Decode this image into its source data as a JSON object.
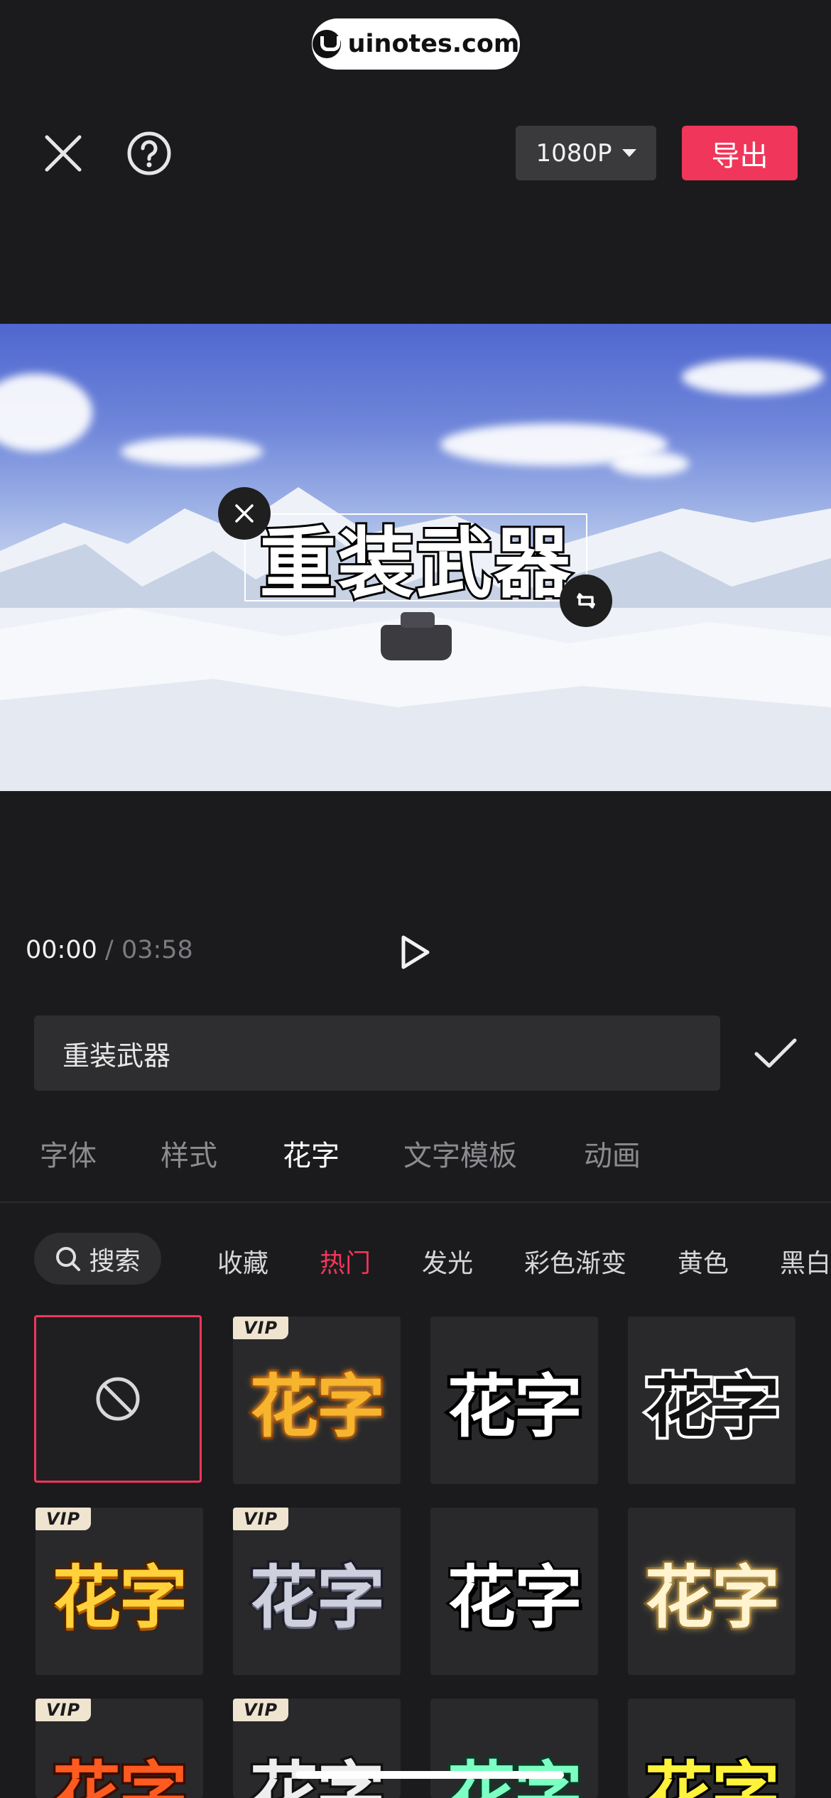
{
  "watermark": {
    "text": "uinotes.com"
  },
  "header": {
    "close_icon": "close-icon",
    "help_icon": "help-icon",
    "resolution_label": "1080P",
    "export_label": "导出"
  },
  "video": {
    "overlay_text": "重装武器"
  },
  "playback": {
    "current": "00:00",
    "separator": "/",
    "total": "03:58",
    "play_icon": "play-icon"
  },
  "editor": {
    "input_value": "重装武器",
    "confirm_icon": "check-icon",
    "tabs": [
      {
        "label": "字体",
        "active": false
      },
      {
        "label": "样式",
        "active": false
      },
      {
        "label": "花字",
        "active": true
      },
      {
        "label": "文字模板",
        "active": false
      },
      {
        "label": "动画",
        "active": false
      }
    ],
    "search_label": "搜索",
    "categories": [
      {
        "label": "收藏",
        "active": false
      },
      {
        "label": "热门",
        "active": true
      },
      {
        "label": "发光",
        "active": false
      },
      {
        "label": "彩色渐变",
        "active": false
      },
      {
        "label": "黄色",
        "active": false
      },
      {
        "label": "黑白",
        "active": false
      }
    ],
    "vip_badge": "VIP",
    "preset_text": "花字",
    "presets": [
      {
        "style": "none",
        "vip": false,
        "selected": true
      },
      {
        "style": "gold-glow",
        "vip": true
      },
      {
        "style": "white-black-outline",
        "vip": false
      },
      {
        "style": "black-white-outline",
        "vip": false
      },
      {
        "style": "yellow-gradient",
        "vip": true
      },
      {
        "style": "silver-gradient",
        "vip": true
      },
      {
        "style": "white-drop-shadow",
        "vip": false
      },
      {
        "style": "cream-glow",
        "vip": false
      },
      {
        "style": "orange",
        "vip": true
      },
      {
        "style": "mono",
        "vip": true
      },
      {
        "style": "mint",
        "vip": false
      },
      {
        "style": "lemon",
        "vip": false
      }
    ]
  },
  "colors": {
    "accent": "#f0365a",
    "background": "#1b1b1d",
    "panel_field": "#2e2e30"
  }
}
